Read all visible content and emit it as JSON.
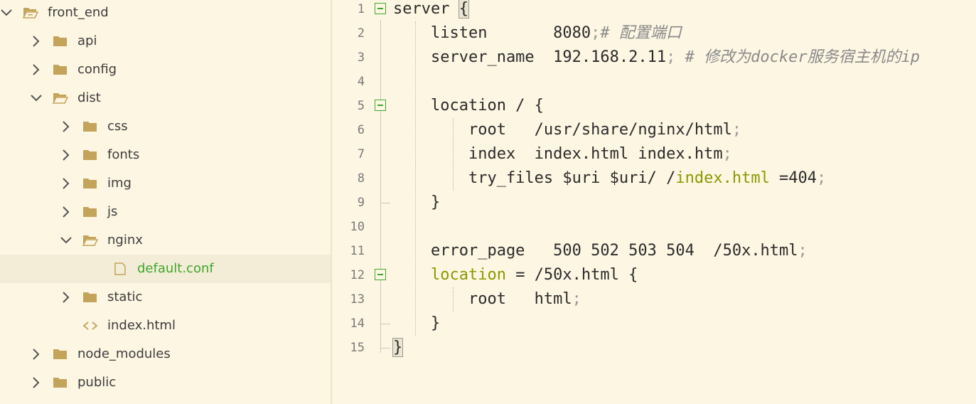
{
  "sidebar": {
    "items": [
      {
        "label": "front_end",
        "depth": 0,
        "expanded": true,
        "type": "folder"
      },
      {
        "label": "api",
        "depth": 1,
        "expanded": false,
        "type": "folder"
      },
      {
        "label": "config",
        "depth": 1,
        "expanded": false,
        "type": "folder"
      },
      {
        "label": "dist",
        "depth": 1,
        "expanded": true,
        "type": "folder"
      },
      {
        "label": "css",
        "depth": 2,
        "expanded": false,
        "type": "folder"
      },
      {
        "label": "fonts",
        "depth": 2,
        "expanded": false,
        "type": "folder"
      },
      {
        "label": "img",
        "depth": 2,
        "expanded": false,
        "type": "folder"
      },
      {
        "label": "js",
        "depth": 2,
        "expanded": false,
        "type": "folder"
      },
      {
        "label": "nginx",
        "depth": 2,
        "expanded": true,
        "type": "folder"
      },
      {
        "label": "default.conf",
        "depth": 3,
        "type": "file",
        "selected": true
      },
      {
        "label": "static",
        "depth": 2,
        "expanded": false,
        "type": "folder"
      },
      {
        "label": "index.html",
        "depth": 2,
        "type": "html"
      },
      {
        "label": "node_modules",
        "depth": 1,
        "expanded": false,
        "type": "folder"
      },
      {
        "label": "public",
        "depth": 1,
        "expanded": false,
        "type": "folder"
      }
    ]
  },
  "editor": {
    "lines": [
      {
        "n": "1",
        "parts": [
          [
            "t",
            "server "
          ],
          [
            "h",
            "{"
          ]
        ]
      },
      {
        "n": "2",
        "parts": [
          [
            "t",
            "    listen       8080"
          ],
          [
            "s",
            ";"
          ],
          [
            "c",
            "# 配置端口"
          ]
        ]
      },
      {
        "n": "3",
        "parts": [
          [
            "t",
            "    server_name  192.168.2.11"
          ],
          [
            "s",
            ";"
          ],
          [
            "c",
            " # 修改为docker服务宿主机的ip"
          ]
        ]
      },
      {
        "n": "4",
        "parts": []
      },
      {
        "n": "5",
        "parts": [
          [
            "t",
            "    location / {"
          ]
        ]
      },
      {
        "n": "6",
        "parts": [
          [
            "t",
            "        root   /usr/share/nginx/html"
          ],
          [
            "s",
            ";"
          ]
        ]
      },
      {
        "n": "7",
        "parts": [
          [
            "t",
            "        index  index.html index.htm"
          ],
          [
            "s",
            ";"
          ]
        ]
      },
      {
        "n": "8",
        "parts": [
          [
            "t",
            "        try_files $uri $uri/ /"
          ],
          [
            "k",
            "index.html"
          ],
          [
            "t",
            " =404"
          ],
          [
            "s",
            ";"
          ]
        ]
      },
      {
        "n": "9",
        "parts": [
          [
            "t",
            "    }"
          ]
        ]
      },
      {
        "n": "10",
        "parts": []
      },
      {
        "n": "11",
        "parts": [
          [
            "t",
            "    error_page   500 502 503 504  /50x.html"
          ],
          [
            "s",
            ";"
          ]
        ]
      },
      {
        "n": "12",
        "parts": [
          [
            "t",
            "    "
          ],
          [
            "k",
            "location"
          ],
          [
            "t",
            " = /50x.html {"
          ]
        ]
      },
      {
        "n": "13",
        "parts": [
          [
            "t",
            "        root   html"
          ],
          [
            "s",
            ";"
          ]
        ]
      },
      {
        "n": "14",
        "parts": [
          [
            "t",
            "    }"
          ]
        ]
      },
      {
        "n": "15",
        "parts": [
          [
            "h",
            "}"
          ]
        ]
      }
    ]
  },
  "colors": {
    "background": "#fdf6e3",
    "selected_file": "#3fa62e",
    "folder_icon": "#c4a35a",
    "keyword": "#8a9a00",
    "comment": "#8a8a8a"
  }
}
